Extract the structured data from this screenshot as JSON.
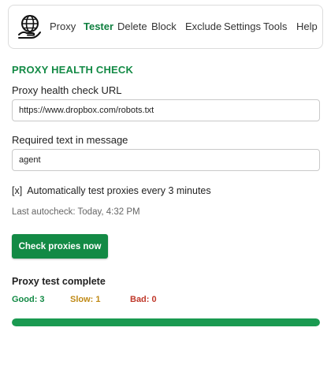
{
  "nav": {
    "items": [
      "Proxy",
      "Tester",
      "Delete",
      "Block",
      "Exclude",
      "Settings",
      "Tools",
      "Help"
    ],
    "active": "Tester"
  },
  "section_title": "PROXY HEALTH CHECK",
  "url_field": {
    "label": "Proxy health check URL",
    "value": "https://www.dropbox.com/robots.txt"
  },
  "text_field": {
    "label": "Required text in message",
    "value": "agent"
  },
  "autotest": {
    "checkbox": "[x]",
    "label": "Automatically test proxies every 3 minutes"
  },
  "last_autocheck": "Last autocheck: Today, 4:32 PM",
  "check_button": "Check proxies now",
  "results": {
    "title": "Proxy test complete",
    "good": "Good: 3",
    "slow": "Slow: 1",
    "bad": "Bad: 0"
  },
  "progress": {
    "fraction": 1.0
  },
  "colors": {
    "accent": "#138a45",
    "good": "#138a45",
    "slow": "#c08a16",
    "bad": "#c0392b",
    "progress": "#1a9a51"
  },
  "icons": {
    "logo": "globe-hand-icon"
  }
}
